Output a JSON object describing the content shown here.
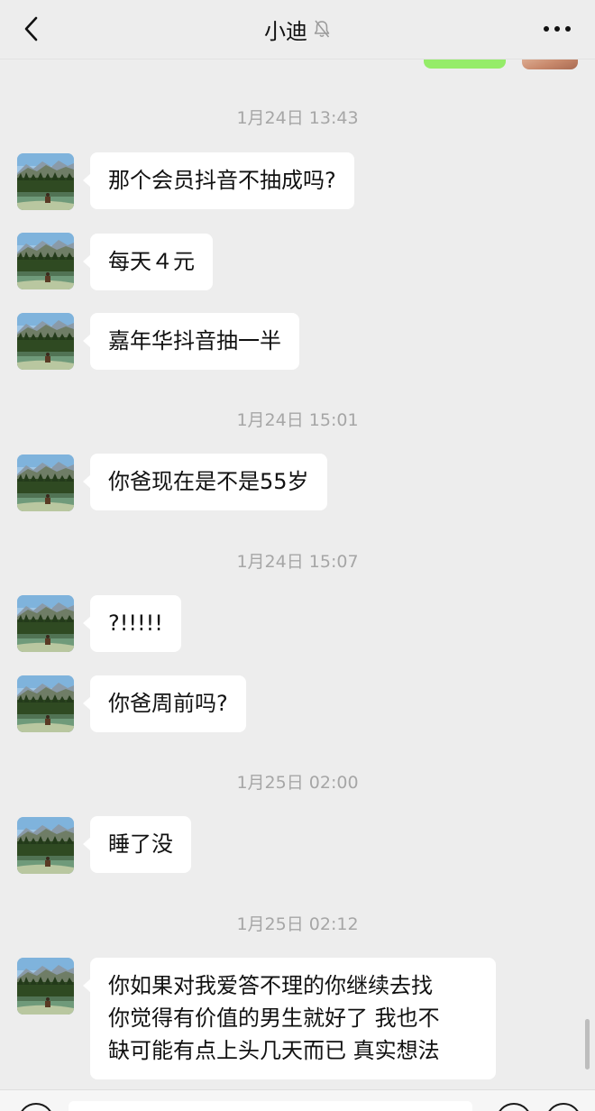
{
  "header": {
    "title": "小迪",
    "back_icon": "chevron-left-icon",
    "mute_icon": "bell-muted-icon",
    "more_icon": "ellipsis-icon"
  },
  "messages": [
    {
      "type": "time",
      "text": "1月24日 13:43"
    },
    {
      "type": "msg",
      "text": "那个会员抖音不抽成吗?"
    },
    {
      "type": "msg",
      "text": "每天４元"
    },
    {
      "type": "msg",
      "text": "嘉年华抖音抽一半"
    },
    {
      "type": "time",
      "text": "1月24日 15:01"
    },
    {
      "type": "msg",
      "text": "你爸现在是不是55岁"
    },
    {
      "type": "time",
      "text": "1月24日 15:07"
    },
    {
      "type": "msg",
      "text": "?!!!!!"
    },
    {
      "type": "msg",
      "text": "你爸周前吗?"
    },
    {
      "type": "time",
      "text": "1月25日 02:00"
    },
    {
      "type": "msg",
      "text": "睡了没"
    },
    {
      "type": "time",
      "text": "1月25日 02:12"
    },
    {
      "type": "msg",
      "lines": [
        "你如果对我爱答不理的你继续去找",
        "你觉得有价值的男生就好了 我也不",
        "缺可能有点上头几天而已 真实想法"
      ]
    }
  ],
  "colors": {
    "background": "#ededed",
    "bubble_incoming": "#ffffff",
    "bubble_outgoing": "#95ec69",
    "timestamp": "#a6a6a6"
  }
}
